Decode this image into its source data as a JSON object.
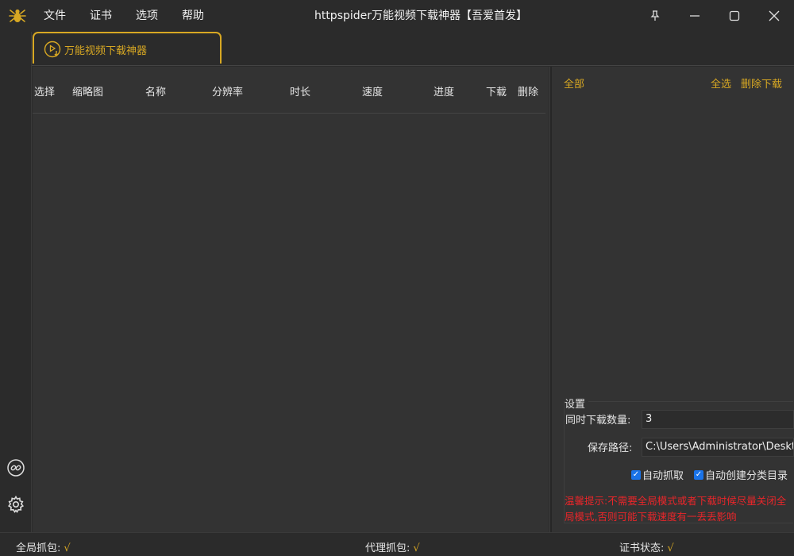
{
  "app": {
    "title": "httpspider万能视频下载神器【吾爱首发】",
    "accent": "#d8a823",
    "warning_color": "#e8262a",
    "logo_icon": "spider-icon"
  },
  "menu": [
    "文件",
    "证书",
    "选项",
    "帮助"
  ],
  "window_controls": [
    "pin-icon",
    "minimize-icon",
    "maximize-icon",
    "close-icon"
  ],
  "tab": {
    "label": "万能视频下载神器",
    "icon": "play-download-icon"
  },
  "sidebar": {
    "icons": [
      "link-icon",
      "gear-icon"
    ]
  },
  "table": {
    "columns": [
      "选择",
      "缩略图",
      "名称",
      "分辨率",
      "时长",
      "速度",
      "进度",
      "下载",
      "删除"
    ],
    "rows": []
  },
  "right_panel": {
    "filter": "全部",
    "select_all": "全选",
    "delete_download": "删除下载"
  },
  "settings": {
    "title": "设置",
    "concurrent_label": "同时下载数量:",
    "concurrent_value": "3",
    "path_label": "保存路径:",
    "path_value": "C:\\Users\\Administrator\\Desktop",
    "auto_capture": {
      "label": "自动抓取",
      "checked": true
    },
    "auto_dir": {
      "label": "自动创建分类目录",
      "checked": true
    },
    "warning": "温馨提示:不需要全局模式或者下载时候尽量关闭全局模式,否则可能下载速度有一丢丢影响"
  },
  "status": {
    "global_label": "全局抓包:",
    "global_mark": "√",
    "proxy_label": "代理抓包:",
    "proxy_mark": "√",
    "cert_label": "证书状态:",
    "cert_mark": "√"
  }
}
